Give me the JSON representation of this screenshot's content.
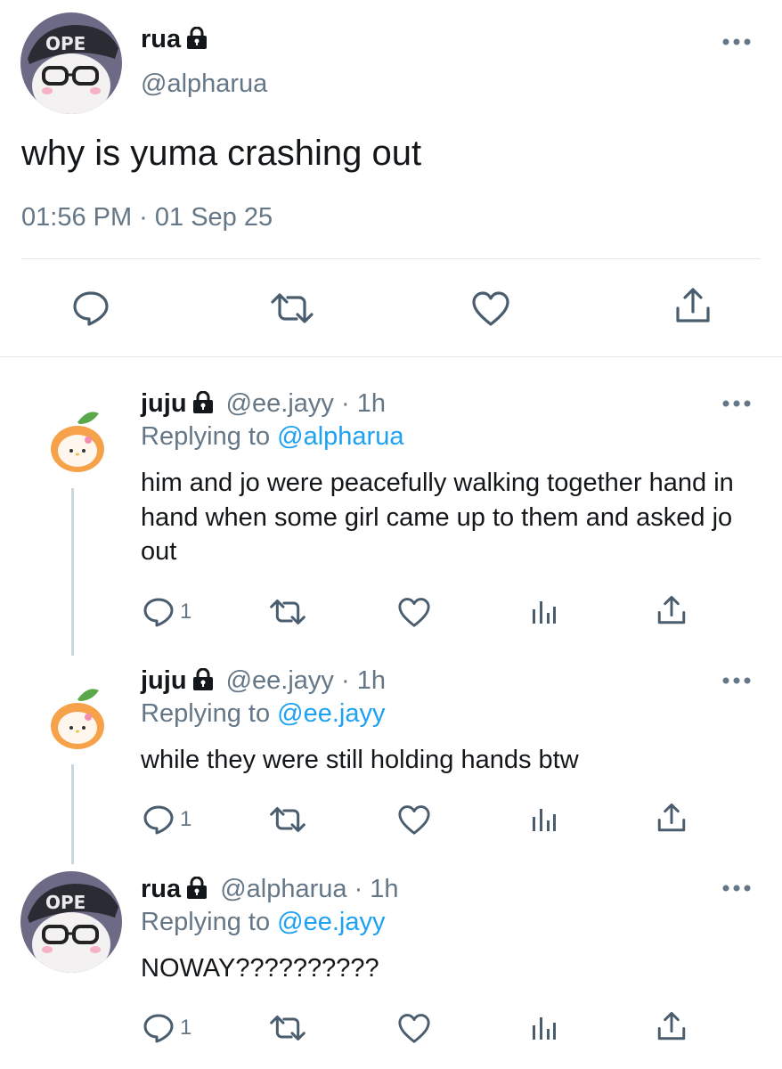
{
  "main_tweet": {
    "name": "rua",
    "handle": "@alpharua",
    "text": "why is yuma crashing out",
    "timestamp": "01:56 PM · 01 Sep 25",
    "actions": [
      "comment-icon",
      "retweet-icon",
      "like-icon",
      "share-icon"
    ]
  },
  "replies": [
    {
      "name": "juju",
      "handle": "@ee.jayy",
      "time": "· 1h",
      "replying_prefix": "Replying to",
      "replying_to": "@alpharua",
      "text": "him and jo were peacefully walking together hand in hand when some girl came up to them and asked jo out",
      "reply_count": "1"
    },
    {
      "name": "juju",
      "handle": "@ee.jayy",
      "time": "· 1h",
      "replying_prefix": "Replying to",
      "replying_to": "@ee.jayy",
      "text": "while they were still holding hands btw",
      "reply_count": "1"
    },
    {
      "name": "rua",
      "handle": "@alpharua",
      "time": "· 1h",
      "replying_prefix": "Replying to",
      "replying_to": "@ee.jayy",
      "text": "NOWAY??????????",
      "reply_count": "1"
    }
  ],
  "colors": {
    "accent_blue": "#1da1f2",
    "secondary_gray": "#657786",
    "icon_gray": "#4a5d6e",
    "divider": "#e1e8ed"
  }
}
